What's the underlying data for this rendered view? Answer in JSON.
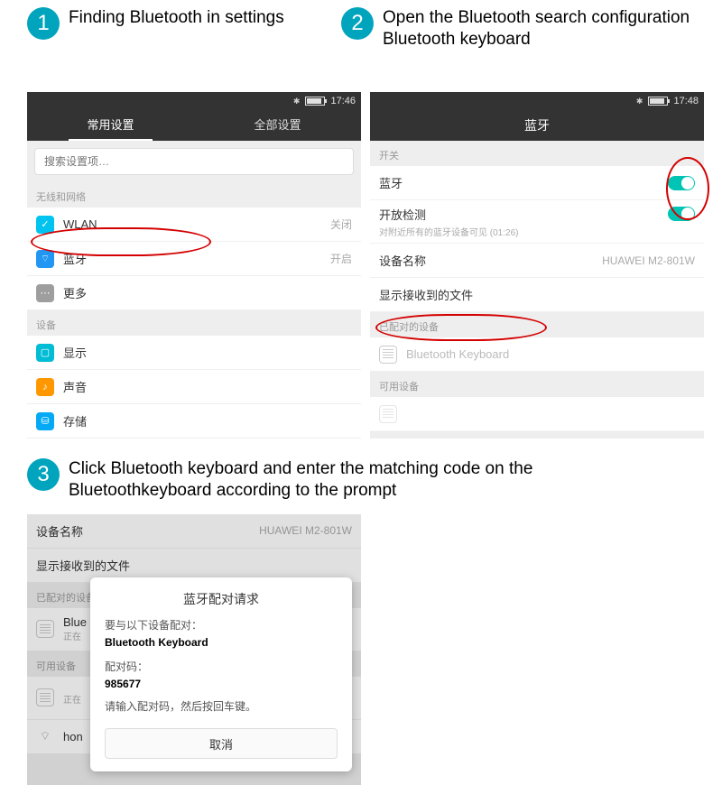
{
  "steps": {
    "s1": {
      "num": "1",
      "text": "Finding Bluetooth in settings"
    },
    "s2": {
      "num": "2",
      "text": "Open the Bluetooth search configuration Bluetooth keyboard"
    },
    "s3": {
      "num": "3",
      "text": "Click Bluetooth keyboard and enter the matching code on the Bluetoothkeyboard according to the prompt"
    }
  },
  "colors": {
    "accent": "#00a4bd"
  },
  "panel1": {
    "statusbar": {
      "time": "17:46"
    },
    "tabs": {
      "common": "常用设置",
      "all": "全部设置"
    },
    "search_placeholder": "搜索设置项…",
    "section_wireless": "无线和网络",
    "wlan_label": "WLAN",
    "wlan_value": "关闭",
    "bt_label": "蓝牙",
    "bt_value": "开启",
    "more_label": "更多",
    "section_device": "设备",
    "display_label": "显示",
    "sound_label": "声音",
    "storage_label": "存储"
  },
  "panel2": {
    "statusbar": {
      "time": "17:48"
    },
    "title": "蓝牙",
    "section_switch": "开关",
    "bt_label": "蓝牙",
    "discover_label": "开放检测",
    "discover_sub": "对附近所有的蓝牙设备可见 (01:26)",
    "devname_label": "设备名称",
    "devname_value": "HUAWEI M2-801W",
    "received_label": "显示接收到的文件",
    "section_paired": "已配对的设备",
    "paired_device": "Bluetooth Keyboard",
    "section_available": "可用设备"
  },
  "panel3": {
    "devname_label": "设备名称",
    "devname_value": "HUAWEI M2-801W",
    "received_label": "显示接收到的文件",
    "section_paired": "已配对的设备",
    "paired_prefix": "Blue",
    "paired_status": "正在",
    "section_available": "可用设备",
    "avail_prefix": "正在",
    "hon_device": "hon",
    "modal": {
      "title": "蓝牙配对请求",
      "pair_with_label": "要与以下设备配对：",
      "device": "Bluetooth Keyboard",
      "code_label": "配对码：",
      "code": "985677",
      "instruction": "请输入配对码，然后按回车键。",
      "cancel": "取消"
    }
  }
}
